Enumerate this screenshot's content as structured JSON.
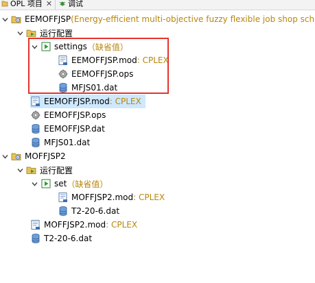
{
  "tabs": [
    {
      "label": "OPL 项目",
      "close": "✕"
    },
    {
      "label": "调试"
    }
  ],
  "tree": [
    {
      "label": "EEMOFFJSP",
      "suffix": " (Energy-efficient multi-objective fuzzy flexible job shop sche"
    },
    {
      "label": "运行配置"
    },
    {
      "label": "settings",
      "suffix": "（缺省值）"
    },
    {
      "label": "EEMOFFJSP.mod",
      "suffix": " : CPLEX"
    },
    {
      "label": "EEMOFFJSP.ops"
    },
    {
      "label": "MFJS01.dat"
    },
    {
      "label": "EEMOFFJSP.mod",
      "suffix": " : CPLEX"
    },
    {
      "label": "EEMOFFJSP.ops"
    },
    {
      "label": "EEMOFFJSP.dat"
    },
    {
      "label": "MFJS01.dat"
    },
    {
      "label": "MOFFJSP2"
    },
    {
      "label": "运行配置"
    },
    {
      "label": "set",
      "suffix": "（缺省值）"
    },
    {
      "label": "MOFFJSP2.mod",
      "suffix": " : CPLEX"
    },
    {
      "label": "T2-20-6.dat"
    },
    {
      "label": "MOFFJSP2.mod",
      "suffix": " : CPLEX"
    },
    {
      "label": "T2-20-6.dat"
    }
  ]
}
